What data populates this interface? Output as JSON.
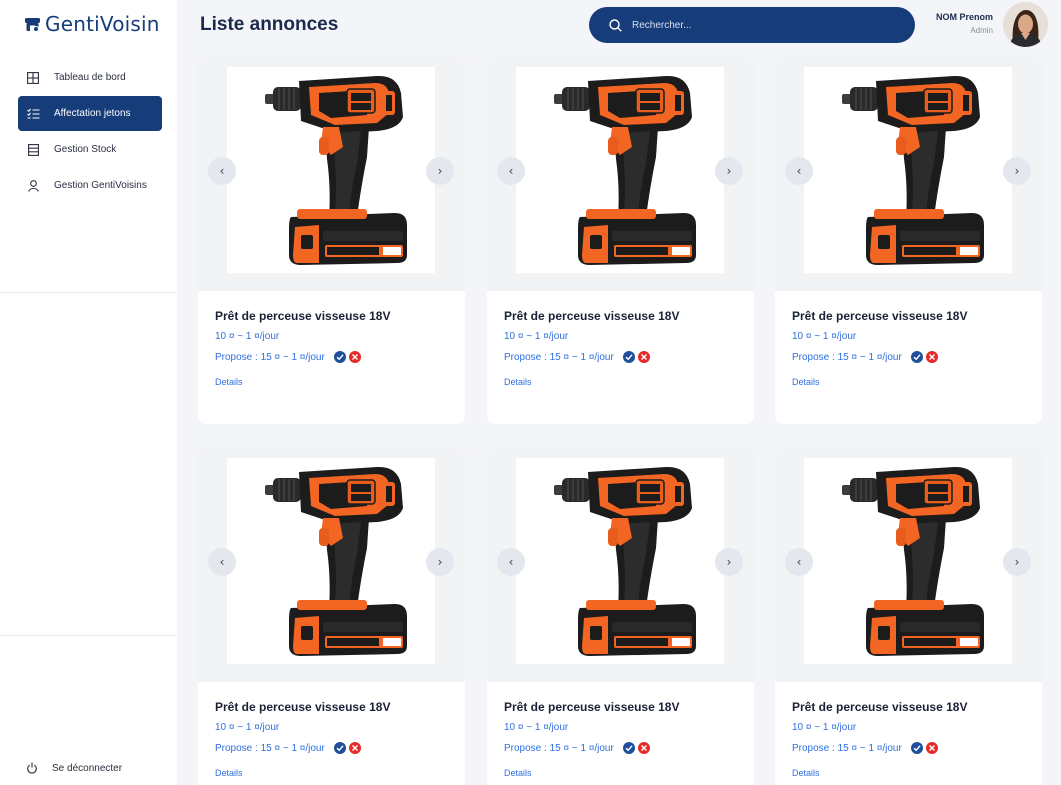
{
  "app": {
    "name": "GentiVoisin"
  },
  "header": {
    "title": "Liste annonces",
    "search_placeholder": "Rechercher...",
    "user": {
      "name": "NOM Prenom",
      "role": "Admin"
    }
  },
  "sidebar": {
    "items": [
      {
        "label": "Tableau de bord",
        "icon": "grid-icon"
      },
      {
        "label": "Affectation jetons",
        "icon": "list-checks-icon",
        "active": true
      },
      {
        "label": "Gestion Stock",
        "icon": "stock-icon"
      },
      {
        "label": "Gestion GentiVoisins",
        "icon": "user-icon"
      }
    ],
    "logout_label": "Se déconnecter"
  },
  "listings": [
    {
      "title": "Prêt de perceuse visseuse 18V",
      "price": "10 ¤ ~ 1 ¤/jour",
      "proposal": "Propose : 15 ¤ ~ 1 ¤/jour",
      "details": "Details"
    },
    {
      "title": "Prêt de perceuse visseuse 18V",
      "price": "10 ¤ ~ 1 ¤/jour",
      "proposal": "Propose : 15 ¤ ~ 1 ¤/jour",
      "details": "Details"
    },
    {
      "title": "Prêt de perceuse visseuse 18V",
      "price": "10 ¤ ~ 1 ¤/jour",
      "proposal": "Propose : 15 ¤ ~ 1 ¤/jour",
      "details": "Details"
    },
    {
      "title": "Prêt de perceuse visseuse 18V",
      "price": "10 ¤ ~ 1 ¤/jour",
      "proposal": "Propose : 15 ¤ ~ 1 ¤/jour",
      "details": "Details"
    },
    {
      "title": "Prêt de perceuse visseuse 18V",
      "price": "10 ¤ ~ 1 ¤/jour",
      "proposal": "Propose : 15 ¤ ~ 1 ¤/jour",
      "details": "Details"
    },
    {
      "title": "Prêt de perceuse visseuse 18V",
      "price": "10 ¤ ~ 1 ¤/jour",
      "proposal": "Propose : 15 ¤ ~ 1 ¤/jour",
      "details": "Details"
    }
  ],
  "colors": {
    "primary": "#163d7a",
    "link": "#2f6fe0",
    "accept": "#1f4f9c",
    "reject": "#e52a2a",
    "drill_orange": "#f26522",
    "drill_black": "#1c1c1c"
  }
}
